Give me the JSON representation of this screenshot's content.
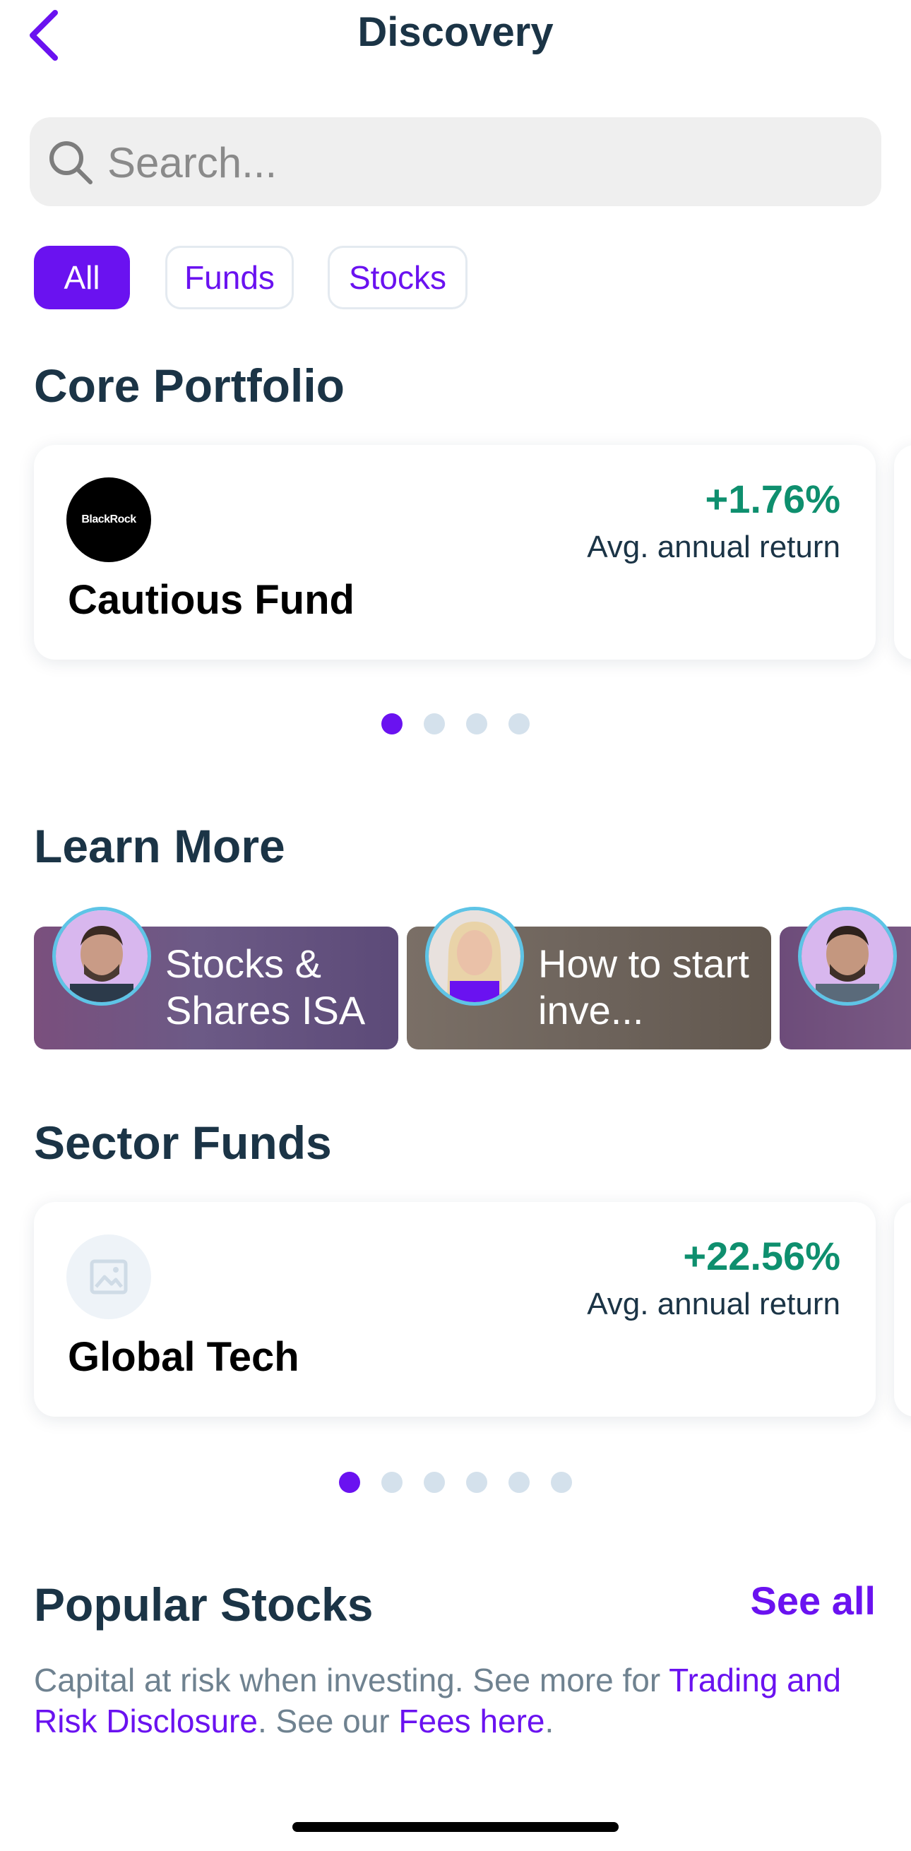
{
  "header": {
    "title": "Discovery"
  },
  "search": {
    "placeholder": "Search..."
  },
  "filters": {
    "all": "All",
    "funds": "Funds",
    "stocks": "Stocks"
  },
  "core_portfolio": {
    "title": "Core Portfolio",
    "card": {
      "logo_text": "BlackRock",
      "name": "Cautious Fund",
      "return": "+1.76%",
      "return_label": "Avg. annual return"
    }
  },
  "learn_more": {
    "title": "Learn More",
    "videos": [
      {
        "title": "Stocks & Shares ISA"
      },
      {
        "title": "How to start inve..."
      },
      {
        "title": ""
      }
    ]
  },
  "sector_funds": {
    "title": "Sector Funds",
    "card": {
      "name": "Global Tech",
      "return": "+22.56%",
      "return_label": "Avg. annual return"
    }
  },
  "popular_stocks": {
    "title": "Popular Stocks",
    "see_all": "See all"
  },
  "disclaimer": {
    "text1": "Capital at risk when investing. See more for ",
    "link1": "Trading and Risk Disclosure",
    "text2": ". See our ",
    "link2": "Fees here",
    "text3": "."
  },
  "colors": {
    "accent": "#6a12f0",
    "positive": "#0e8f6e",
    "heading": "#1b3446"
  },
  "carousel": {
    "core_pages": 4,
    "core_active": 1,
    "sector_pages": 6,
    "sector_active": 1
  }
}
